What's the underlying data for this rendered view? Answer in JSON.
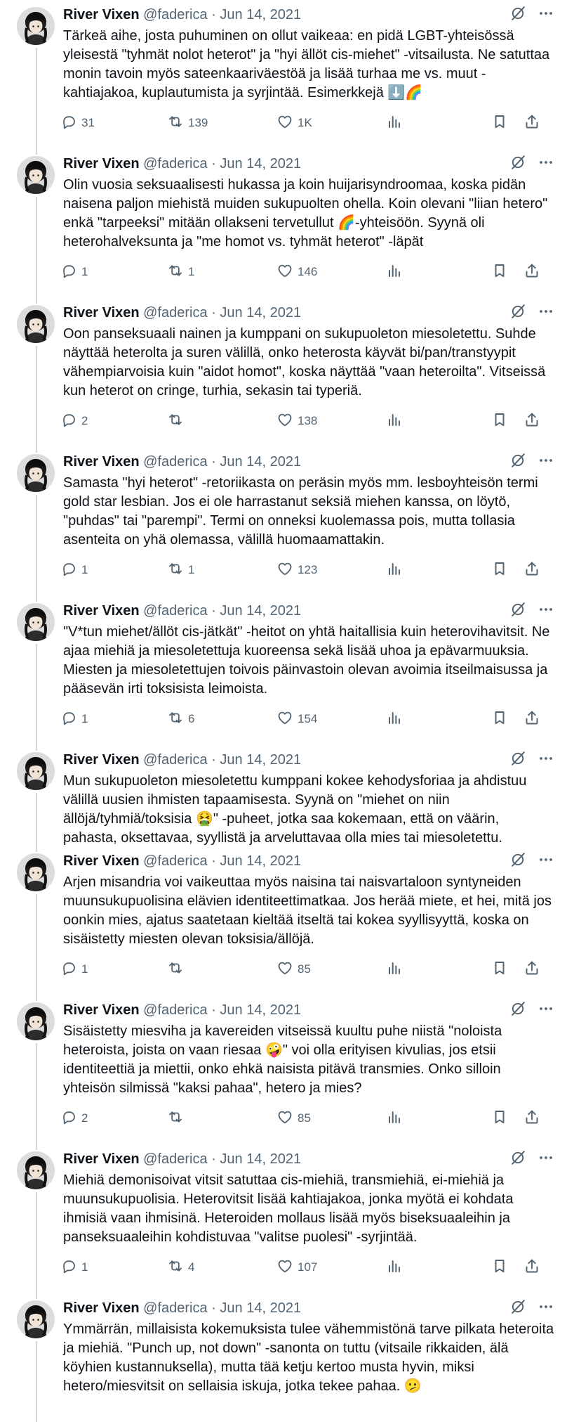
{
  "author": {
    "name": "River Vixen",
    "handle": "@faderica",
    "separator": "·"
  },
  "tweets": [
    {
      "date": "Jun 14, 2021",
      "text": "Tärkeä aihe, josta puhuminen on ollut vaikeaa: en pidä LGBT-yhteisössä yleisestä \"tyhmät nolot heterot\" ja \"hyi ällöt cis-miehet\" -vitsailusta. Ne satuttaa monin tavoin myös sateenkaariväestöä ja lisää turhaa me vs. muut -kahtiajakoa, kuplautumista ja syrjintää. Esimerkkejä ⬇️🌈",
      "replies": "31",
      "retweets": "139",
      "likes": "1K",
      "views": ""
    },
    {
      "date": "Jun 14, 2021",
      "text": "Olin vuosia seksuaalisesti hukassa ja koin huijarisyndroomaa, koska pidän naisena paljon miehistä muiden sukupuolten ohella. Koin olevani \"liian hetero\" enkä \"tarpeeksi\" mitään ollakseni tervetullut 🌈-yhteisöön. Syynä oli heterohalveksunta ja \"me homot vs. tyhmät heterot\" -läpät",
      "replies": "1",
      "retweets": "1",
      "likes": "146",
      "views": ""
    },
    {
      "date": "Jun 14, 2021",
      "text": "Oon panseksuaali nainen ja kumppani on sukupuoleton miesoletettu. Suhde näyttää heterolta ja suren välillä, onko heterosta käyvät bi/pan/transtyypit vähempiarvoisia kuin \"aidot homot\", koska näyttää \"vaan heteroilta\". Vitseissä kun heterot on cringe, turhia, sekasin tai typeriä.",
      "replies": "2",
      "retweets": "",
      "likes": "138",
      "views": ""
    },
    {
      "date": "Jun 14, 2021",
      "text": "Samasta \"hyi heterot\" -retoriikasta on peräsin myös mm. lesboyhteisön termi gold star lesbian. Jos ei ole harrastanut seksiä miehen kanssa, on löytö, \"puhdas\" tai \"parempi\". Termi on onneksi kuolemassa pois, mutta tollasia asenteita on yhä olemassa, välillä huomaamattakin.",
      "replies": "1",
      "retweets": "1",
      "likes": "123",
      "views": ""
    },
    {
      "date": "Jun 14, 2021",
      "text": "\"V*tun miehet/ällöt cis-jätkät\" -heitot on yhtä haitallisia kuin heterovihavitsit. Ne ajaa miehiä ja miesoletettuja kuoreensa sekä lisää uhoa ja epävarmuuksia. Miesten ja miesoletettujen toivois päinvastoin olevan avoimia itseilmaisussa ja pääsevän irti toksisista leimoista.",
      "replies": "1",
      "retweets": "6",
      "likes": "154",
      "views": ""
    },
    {
      "date": "Jun 14, 2021",
      "text": "Mun sukupuoleton miesoletettu kumppani kokee kehodysforiaa ja ahdistuu välillä uusien ihmisten tapaamisesta. Syynä on \"miehet on niin ällöjä/tyhmiä/toksisia 🤮\" -puheet, jotka saa kokemaan, että on väärin, pahasta, oksettavaa, syyllistä ja arveluttavaa olla mies tai miesoletettu.",
      "replies": "",
      "retweets": "",
      "likes": "",
      "views": ""
    },
    {
      "date": "Jun 14, 2021",
      "text": "Arjen misandria voi vaikeuttaa myös naisina tai naisvartaloon syntyneiden muunsukupuolisina elävien identiteettimatkaa. Jos herää miete, et hei, mitä jos oonkin mies, ajatus saatetaan kieltää itseltä tai kokea syyllisyyttä, koska on sisäistetty miesten olevan toksisia/ällöjä.",
      "replies": "1",
      "retweets": "",
      "likes": "85",
      "views": ""
    },
    {
      "date": "Jun 14, 2021",
      "text": "Sisäistetty miesviha ja kavereiden vitseissä kuultu puhe niistä \"noloista heteroista, joista on vaan riesaa 🤪\" voi olla erityisen kivulias, jos etsii identiteettiä ja miettii, onko ehkä naisista pitävä transmies. Onko silloin yhteisön silmissä \"kaksi pahaa\", hetero ja mies?",
      "replies": "2",
      "retweets": "",
      "likes": "85",
      "views": ""
    },
    {
      "date": "Jun 14, 2021",
      "text": "Miehiä demonisoivat vitsit satuttaa cis-miehiä, transmiehiä, ei-miehiä ja muunsukupuolisia. Heterovitsit lisää kahtiajakoa, jonka myötä ei kohdata ihmisiä vaan ihmisinä. Heteroiden mollaus lisää myös biseksuaaleihin ja panseksuaaleihin kohdistuvaa \"valitse puolesi\" -syrjintää.",
      "replies": "1",
      "retweets": "4",
      "likes": "107",
      "views": ""
    },
    {
      "date": "Jun 14, 2021",
      "text": "Ymmärrän, millaisista kokemuksista tulee vähemmistönä tarve pilkata heteroita ja miehiä. \"Punch up, not down\" -sanonta on tuttu (vitsaile rikkaiden, älä köyhien kustannuksella), mutta tää ketju kertoo musta hyvin, miksi hetero/miesvitsit on sellaisia iskuja, jotka tekee pahaa. 🫤",
      "replies": "",
      "retweets": "",
      "likes": "",
      "views": ""
    }
  ],
  "colors": {
    "text": "#0f1419",
    "muted": "#536471",
    "rail": "#cfd9de"
  }
}
